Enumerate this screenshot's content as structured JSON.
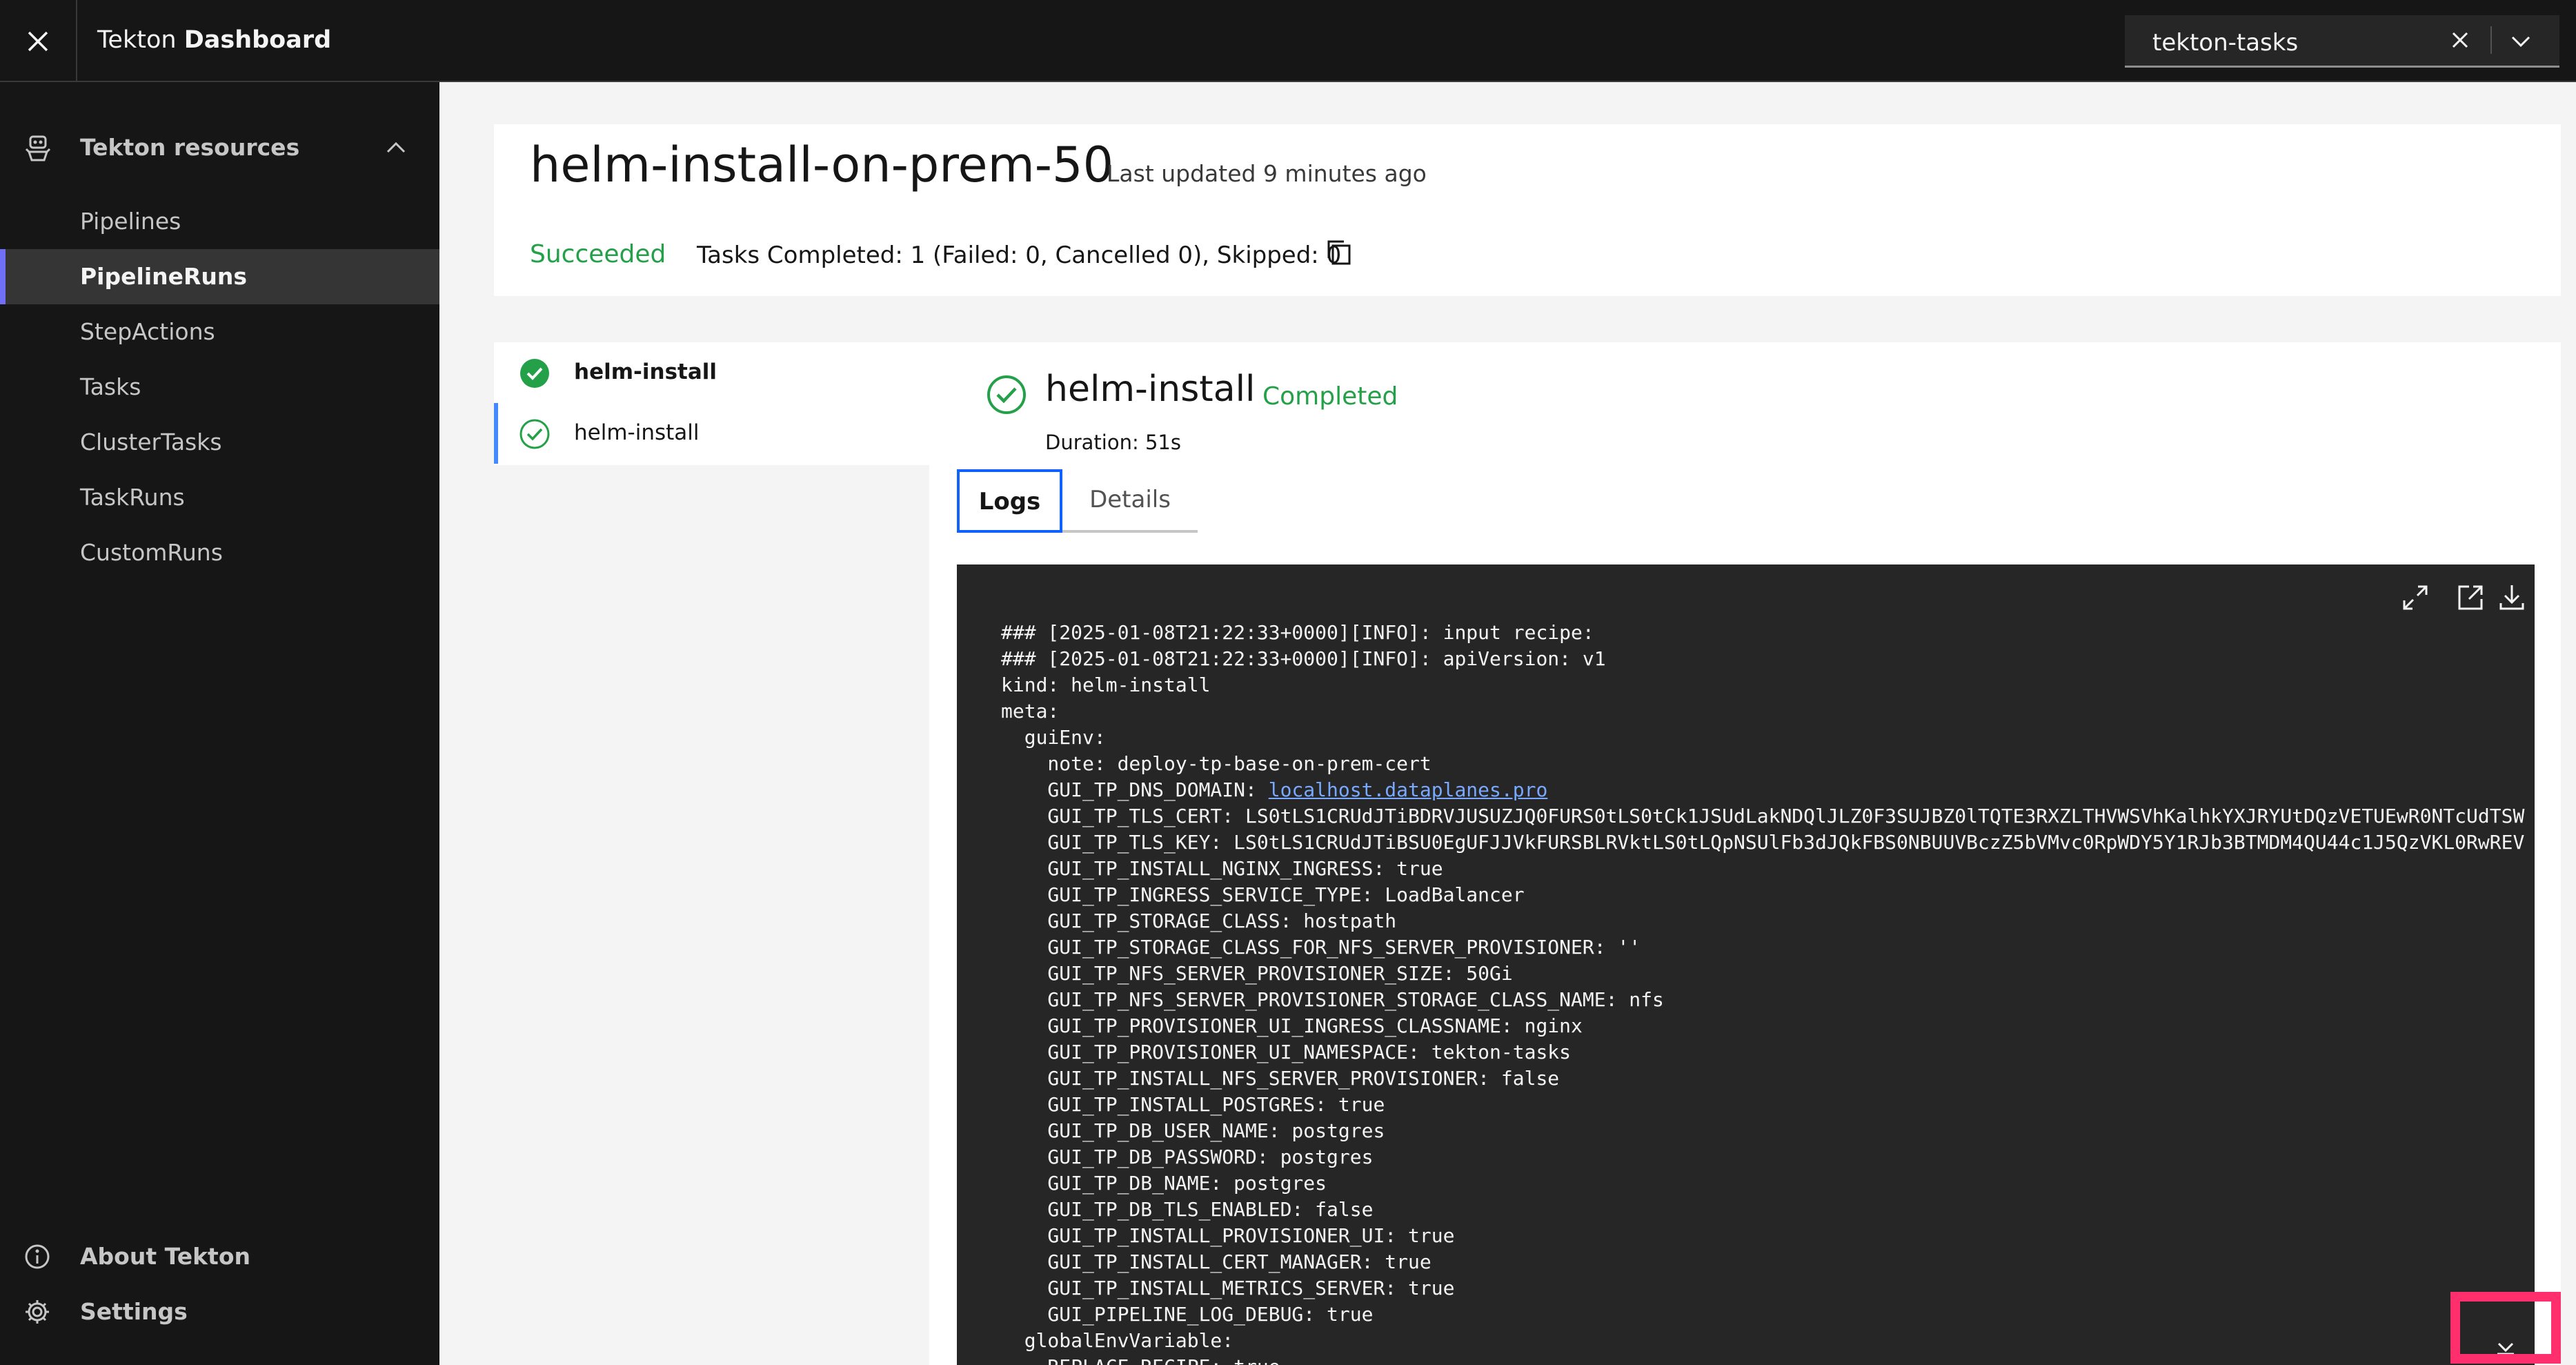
{
  "header": {
    "title_prefix": "Tekton",
    "title_bold": "Dashboard",
    "namespace_value": "tekton-tasks"
  },
  "sidebar": {
    "heading": "Tekton resources",
    "items": [
      {
        "label": "Pipelines",
        "active": false
      },
      {
        "label": "PipelineRuns",
        "active": true
      },
      {
        "label": "StepActions",
        "active": false
      },
      {
        "label": "Tasks",
        "active": false
      },
      {
        "label": "ClusterTasks",
        "active": false
      },
      {
        "label": "TaskRuns",
        "active": false
      },
      {
        "label": "CustomRuns",
        "active": false
      }
    ],
    "about": "About Tekton",
    "settings": "Settings"
  },
  "run": {
    "title": "helm-install-on-prem-50",
    "last_updated": "Last updated 9 minutes ago",
    "status": "Succeeded",
    "summary": "Tasks Completed: 1 (Failed: 0, Cancelled 0), Skipped: 0"
  },
  "tasks": [
    {
      "label": "helm-install",
      "bold": true
    },
    {
      "label": "helm-install",
      "bold": false
    }
  ],
  "step": {
    "title": "helm-install",
    "status": "Completed",
    "duration": "Duration: 51s",
    "tabs": {
      "logs": "Logs",
      "details": "Details"
    }
  },
  "log": {
    "lines": [
      "### [2025-01-08T21:22:33+0000][INFO]: input recipe:",
      "### [2025-01-08T21:22:33+0000][INFO]: apiVersion: v1",
      "kind: helm-install",
      "meta:",
      "  guiEnv:",
      "    note: deploy-tp-base-on-prem-cert",
      "    GUI_TP_DNS_DOMAIN: ",
      "    GUI_TP_TLS_CERT: LS0tLS1CRUdJTiBDRVJUSUZJQ0FURS0tLS0tCk1JSUdLakNDQlJLZ0F3SUJBZ0lTQTE3RXZLTHVWSVhKalhkYXJRYUtDQzVETUEwR0NTcUdTSW",
      "    GUI_TP_TLS_KEY: LS0tLS1CRUdJTiBSU0EgUFJJVkFURSBLRVktLS0tLQpNSUlFb3dJQkFBS0NBUUVBczZ5bVMvc0RpWDY5Y1RJb3BTMDM4QU44c1J5QzVKL0RwREV",
      "    GUI_TP_INSTALL_NGINX_INGRESS: true",
      "    GUI_TP_INGRESS_SERVICE_TYPE: LoadBalancer",
      "    GUI_TP_STORAGE_CLASS: hostpath",
      "    GUI_TP_STORAGE_CLASS_FOR_NFS_SERVER_PROVISIONER: ''",
      "    GUI_TP_NFS_SERVER_PROVISIONER_SIZE: 50Gi",
      "    GUI_TP_NFS_SERVER_PROVISIONER_STORAGE_CLASS_NAME: nfs",
      "    GUI_TP_PROVISIONER_UI_INGRESS_CLASSNAME: nginx",
      "    GUI_TP_PROVISIONER_UI_NAMESPACE: tekton-tasks",
      "    GUI_TP_INSTALL_NFS_SERVER_PROVISIONER: false",
      "    GUI_TP_INSTALL_POSTGRES: true",
      "    GUI_TP_DB_USER_NAME: postgres",
      "    GUI_TP_DB_PASSWORD: postgres",
      "    GUI_TP_DB_NAME: postgres",
      "    GUI_TP_DB_TLS_ENABLED: false",
      "    GUI_TP_INSTALL_PROVISIONER_UI: true",
      "    GUI_TP_INSTALL_CERT_MANAGER: true",
      "    GUI_TP_INSTALL_METRICS_SERVER: true",
      "    GUI_PIPELINE_LOG_DEBUG: true",
      "  globalEnvVariable:",
      "    REPLACE_RECIPE: true"
    ],
    "dns_link": "localhost.dataplanes.pro"
  }
}
